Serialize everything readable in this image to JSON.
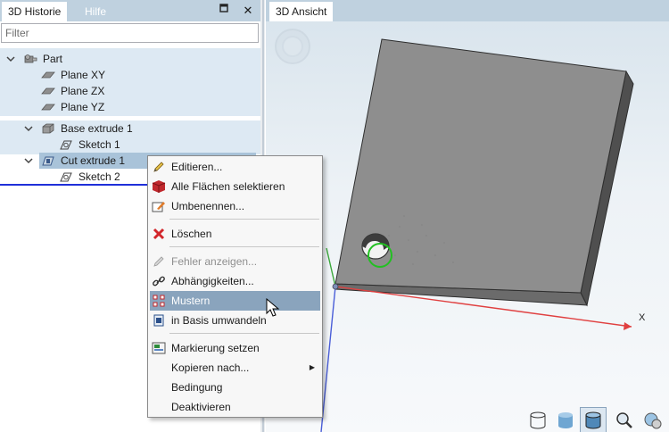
{
  "left_panel": {
    "tabs": [
      {
        "label": "3D Historie",
        "active": true
      },
      {
        "label": "Hilfe",
        "active": false
      }
    ],
    "pin_icon": "pin-icon",
    "close_label": "✕",
    "filter": {
      "placeholder": "Filter",
      "value": ""
    },
    "tree": {
      "part": {
        "label": "Part",
        "expanded": true,
        "planes": [
          "Plane XY",
          "Plane ZX",
          "Plane YZ"
        ]
      },
      "base_extrude": {
        "label": "Base extrude 1",
        "expanded": true,
        "child": "Sketch 1"
      },
      "cut_extrude": {
        "label": "Cut extrude 1",
        "expanded": true,
        "selected": true,
        "child": "Sketch 2"
      }
    }
  },
  "right_panel": {
    "tab": "3D Ansicht",
    "axis_label": "X"
  },
  "context_menu": {
    "items": [
      {
        "label": "Editieren...",
        "icon": "pencil-icon",
        "enabled": true
      },
      {
        "label": "Alle Flächen selektieren",
        "icon": "red-cube-icon",
        "enabled": true
      },
      {
        "label": "Umbenennen...",
        "icon": "rename-icon",
        "enabled": true
      },
      {
        "label": "Löschen",
        "icon": "red-x-icon",
        "enabled": true
      },
      {
        "label": "Fehler anzeigen...",
        "icon": "error-icon",
        "enabled": false
      },
      {
        "label": "Abhängigkeiten...",
        "icon": "link-icon",
        "enabled": true
      },
      {
        "label": "Mustern",
        "icon": "pattern-icon",
        "enabled": true,
        "hovered": true
      },
      {
        "label": "in Basis umwandeln",
        "icon": "convert-icon",
        "enabled": true
      },
      {
        "label": "Markierung setzen",
        "icon": "marker-icon",
        "enabled": true
      },
      {
        "label": "Kopieren nach...",
        "icon": "",
        "enabled": true,
        "submenu": true
      },
      {
        "label": "Bedingung",
        "icon": "",
        "enabled": true
      },
      {
        "label": "Deaktivieren",
        "icon": "",
        "enabled": true
      }
    ]
  },
  "view_toolbar": {
    "buttons": [
      "wireframe-view-icon",
      "shaded-view-icon",
      "shaded-edges-view-icon",
      "zoom-icon",
      "view-options-icon"
    ],
    "active": "shaded-edges-view-icon"
  },
  "colors": {
    "tab_strip": "#bfd1df",
    "selection": "#a9c3d9",
    "menu_hover": "#8aa4bd",
    "plate": "#8e8e8e",
    "axis_x": "#e04040",
    "axis_y": "#3ba83b",
    "axis_z": "#4a5ed8"
  }
}
